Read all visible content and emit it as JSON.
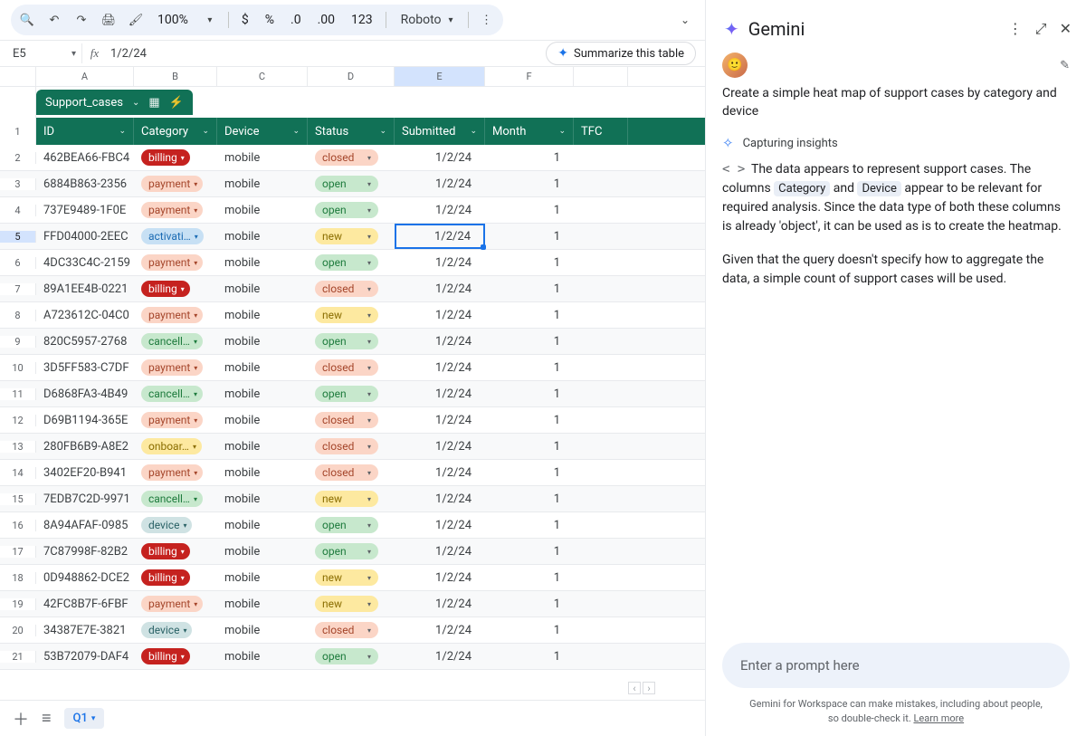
{
  "toolbar": {
    "zoom": "100%",
    "currency": "$",
    "percent": "%",
    "dec_dec": ".0",
    "inc_dec": ".00",
    "num123": "123",
    "font": "Roboto"
  },
  "formula_bar": {
    "cell_ref": "E5",
    "fx_label": "fx",
    "value": "1/2/24",
    "summarize_label": "Summarize this table"
  },
  "columns": [
    "A",
    "B",
    "C",
    "D",
    "E",
    "F"
  ],
  "table": {
    "chip_name": "Support_cases",
    "headers": {
      "id": "ID",
      "category": "Category",
      "device": "Device",
      "status": "Status",
      "submitted": "Submitted",
      "month": "Month",
      "tfc": "TFC"
    }
  },
  "rows": [
    {
      "n": "2",
      "id": "462BEA66-FBC4",
      "cat": "billing",
      "cat_style": "billing",
      "dev": "mobile",
      "st": "closed",
      "sub": "1/2/24",
      "mon": "1"
    },
    {
      "n": "3",
      "id": "6884B863-2356",
      "cat": "payment",
      "cat_style": "payment",
      "dev": "mobile",
      "st": "open",
      "sub": "1/2/24",
      "mon": "1"
    },
    {
      "n": "4",
      "id": "737E9489-1F0E",
      "cat": "payment",
      "cat_style": "payment",
      "dev": "mobile",
      "st": "open",
      "sub": "1/2/24",
      "mon": "1"
    },
    {
      "n": "5",
      "id": "FFD04000-2EEC",
      "cat": "activati…",
      "cat_style": "activation",
      "dev": "mobile",
      "st": "new",
      "sub": "1/2/24",
      "mon": "1",
      "selected": true
    },
    {
      "n": "6",
      "id": "4DC33C4C-2159",
      "cat": "payment",
      "cat_style": "payment",
      "dev": "mobile",
      "st": "open",
      "sub": "1/2/24",
      "mon": "1"
    },
    {
      "n": "7",
      "id": "89A1EE4B-0221",
      "cat": "billing",
      "cat_style": "billing",
      "dev": "mobile",
      "st": "closed",
      "sub": "1/2/24",
      "mon": "1"
    },
    {
      "n": "8",
      "id": "A723612C-04C0",
      "cat": "payment",
      "cat_style": "payment",
      "dev": "mobile",
      "st": "new",
      "sub": "1/2/24",
      "mon": "1"
    },
    {
      "n": "9",
      "id": "820C5957-2768",
      "cat": "cancell…",
      "cat_style": "cancellation",
      "dev": "mobile",
      "st": "open",
      "sub": "1/2/24",
      "mon": "1"
    },
    {
      "n": "10",
      "id": "3D5FF583-C7DF",
      "cat": "payment",
      "cat_style": "payment",
      "dev": "mobile",
      "st": "closed",
      "sub": "1/2/24",
      "mon": "1"
    },
    {
      "n": "11",
      "id": "D6868FA3-4B49",
      "cat": "cancell…",
      "cat_style": "cancellation",
      "dev": "mobile",
      "st": "open",
      "sub": "1/2/24",
      "mon": "1"
    },
    {
      "n": "12",
      "id": "D69B1194-365E",
      "cat": "payment",
      "cat_style": "payment",
      "dev": "mobile",
      "st": "closed",
      "sub": "1/2/24",
      "mon": "1"
    },
    {
      "n": "13",
      "id": "280FB6B9-A8E2",
      "cat": "onboar…",
      "cat_style": "onboarding",
      "dev": "mobile",
      "st": "closed",
      "sub": "1/2/24",
      "mon": "1"
    },
    {
      "n": "14",
      "id": "3402EF20-B941",
      "cat": "payment",
      "cat_style": "payment",
      "dev": "mobile",
      "st": "closed",
      "sub": "1/2/24",
      "mon": "1"
    },
    {
      "n": "15",
      "id": "7EDB7C2D-9971",
      "cat": "cancell…",
      "cat_style": "cancellation",
      "dev": "mobile",
      "st": "new",
      "sub": "1/2/24",
      "mon": "1"
    },
    {
      "n": "16",
      "id": "8A94AFAF-0985",
      "cat": "device",
      "cat_style": "device",
      "dev": "mobile",
      "st": "open",
      "sub": "1/2/24",
      "mon": "1"
    },
    {
      "n": "17",
      "id": "7C87998F-82B2",
      "cat": "billing",
      "cat_style": "billing",
      "dev": "mobile",
      "st": "open",
      "sub": "1/2/24",
      "mon": "1"
    },
    {
      "n": "18",
      "id": "0D948862-DCE2",
      "cat": "billing",
      "cat_style": "billing",
      "dev": "mobile",
      "st": "new",
      "sub": "1/2/24",
      "mon": "1"
    },
    {
      "n": "19",
      "id": "42FC8B7F-6FBF",
      "cat": "payment",
      "cat_style": "payment",
      "dev": "mobile",
      "st": "new",
      "sub": "1/2/24",
      "mon": "1"
    },
    {
      "n": "20",
      "id": "34387E7E-3821",
      "cat": "device",
      "cat_style": "device",
      "dev": "mobile",
      "st": "closed",
      "sub": "1/2/24",
      "mon": "1"
    },
    {
      "n": "21",
      "id": "53B72079-DAF4",
      "cat": "billing",
      "cat_style": "billing",
      "dev": "mobile",
      "st": "open",
      "sub": "1/2/24",
      "mon": "1"
    }
  ],
  "sheet_tab": "Q1",
  "gemini": {
    "title": "Gemini",
    "prompt": "Create a simple heat map of support cases by category and device",
    "insights_label": "Capturing insights",
    "body_pre": "The data appears to represent support cases. The columns ",
    "body_tag1": "Category",
    "body_mid1": " and ",
    "body_tag2": "Device",
    "body_post": " appear to be relevant for required analysis. Since the data type of both these columns is already 'object', it can be used as is to create the heatmap.",
    "body_p2": "Given that the query doesn't specify how to aggregate the data, a simple count of support cases will be used.",
    "input_placeholder": "Enter a prompt here",
    "footnote": "Gemini for Workspace can make mistakes, including about people, so double-check it. ",
    "learn_more": "Learn more"
  }
}
